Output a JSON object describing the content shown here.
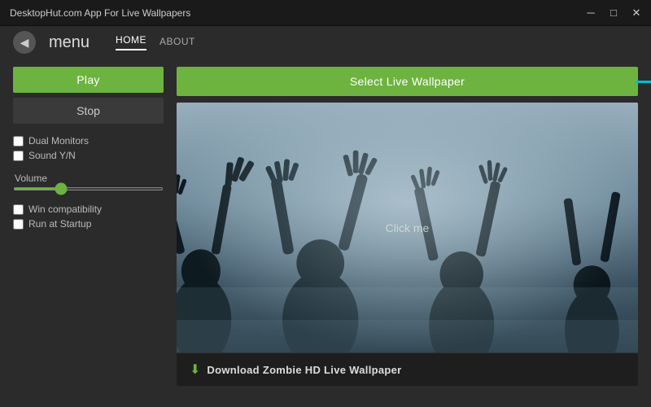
{
  "titleBar": {
    "title": "DesktopHut.com App For Live Wallpapers",
    "minimizeLabel": "─",
    "maximizeLabel": "□",
    "closeLabel": "✕"
  },
  "menuBar": {
    "backIcon": "◀",
    "menuTitle": "menu",
    "navItems": [
      {
        "label": "HOME",
        "active": true
      },
      {
        "label": "ABOUT",
        "active": false
      }
    ]
  },
  "leftPanel": {
    "playLabel": "Play",
    "stopLabel": "Stop",
    "checkboxes": [
      {
        "label": "Dual Monitors",
        "checked": false
      },
      {
        "label": "Sound Y/N",
        "checked": false
      }
    ],
    "volumeLabel": "Volume",
    "checkboxes2": [
      {
        "label": "Win compatibility",
        "checked": false
      },
      {
        "label": "Run at Startup",
        "checked": false
      }
    ]
  },
  "rightPanel": {
    "selectWallpaperLabel": "Select Live Wallpaper",
    "clickMeLabel": "Click me",
    "downloadBarText": "Download Zombie HD Live Wallpaper",
    "downloadIcon": "⬇"
  }
}
